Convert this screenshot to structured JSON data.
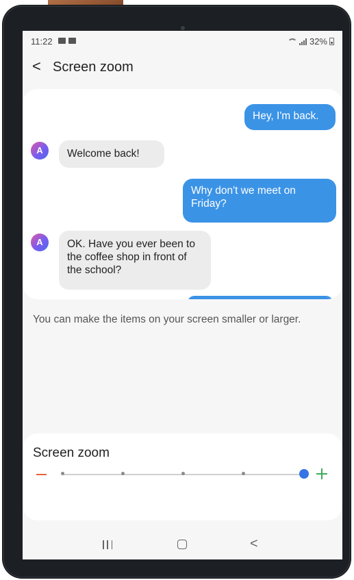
{
  "status_bar": {
    "time": "11:22",
    "battery": "32%"
  },
  "header": {
    "back_icon": "<",
    "title": "Screen zoom"
  },
  "preview": {
    "messages": [
      {
        "direction": "out",
        "text": "Hey, I'm back."
      },
      {
        "direction": "in",
        "avatar": "A",
        "text": "Welcome back!"
      },
      {
        "direction": "out",
        "text": "Why don't we meet on Friday?"
      },
      {
        "direction": "in",
        "avatar": "A",
        "text": "OK. Have you ever been to the coffee shop in front of the school?"
      }
    ]
  },
  "description": "You can make the items on your screen smaller or larger.",
  "zoom": {
    "title": "Screen zoom",
    "steps": 5,
    "current_step": 5
  },
  "colors": {
    "outgoing_bubble": "#3b93e6",
    "minus": "#e8603c",
    "plus": "#3cad5a",
    "slider_thumb": "#3574e6"
  },
  "icons": {
    "back": "chevron-left-icon",
    "decrease": "minus-icon",
    "increase": "plus-icon",
    "nav_recents": "recents-icon",
    "nav_home": "home-icon",
    "nav_back": "back-icon"
  }
}
